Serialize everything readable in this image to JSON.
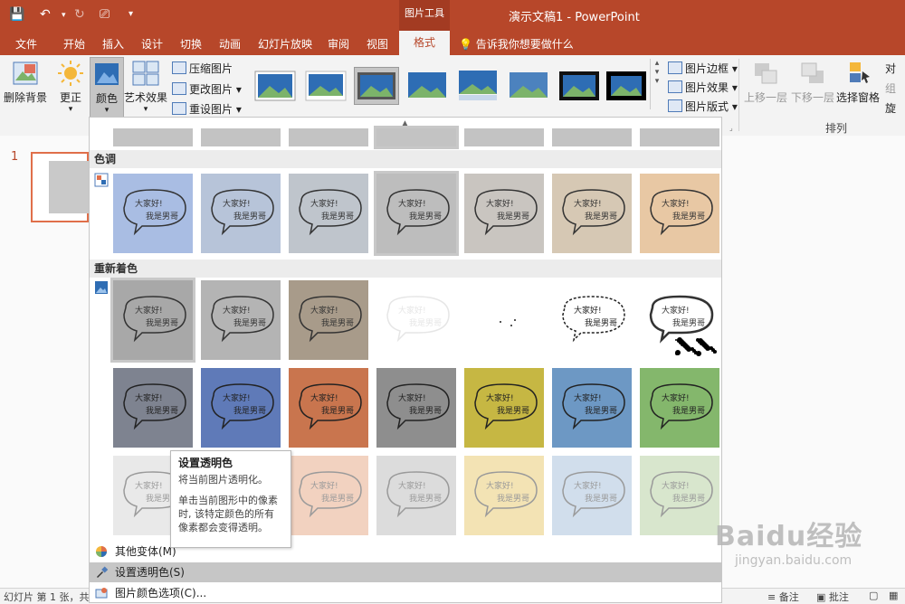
{
  "titlebar": {
    "tool_context": "图片工具",
    "doc_title": "演示文稿1  -  PowerPoint"
  },
  "tabs": [
    {
      "label": "文件"
    },
    {
      "label": "开始"
    },
    {
      "label": "插入"
    },
    {
      "label": "设计"
    },
    {
      "label": "切换"
    },
    {
      "label": "动画"
    },
    {
      "label": "幻灯片放映"
    },
    {
      "label": "审阅"
    },
    {
      "label": "视图"
    },
    {
      "label": "格式"
    }
  ],
  "tellme": "告诉我你想要做什么",
  "ribbon": {
    "remove_bg": "删除背景",
    "corrections": "更正",
    "color": "颜色",
    "artistic": "艺术效果",
    "compress": "压缩图片",
    "change": "更改图片",
    "reset": "重设图片",
    "border": "图片边框",
    "effects": "图片效果",
    "layout": "图片版式",
    "bring_forward": "上移一层",
    "send_backward": "下移一层",
    "selection_pane": "选择窗格",
    "arrange_label": "排列",
    "align_partial": "对",
    "group_partial": "组",
    "rotate_partial": "旋"
  },
  "slidepane": {
    "slide_number": "1"
  },
  "dropdown": {
    "section_tone": "色调",
    "section_recolor": "重新着色",
    "thumb_text_line1": "大家好!",
    "thumb_text_line2": "我是男哥",
    "more_variants": "其他变体(M)",
    "set_transparent": "设置透明色(S)",
    "color_options": "图片颜色选项(C)..."
  },
  "tooltip": {
    "title": "设置透明色",
    "line1": "将当前图片透明化。",
    "line2": "单击当前图形中的像素时, 该特定颜色的所有像素都会变得透明。"
  },
  "status": {
    "slide_info": "幻灯片 第 1 张，共",
    "notes": "备注",
    "comments": "批注"
  },
  "watermark": {
    "brand": "Baidu经验",
    "url": "jingyan.baidu.com"
  },
  "colors": {
    "accent": "#b7472a",
    "tone_row": [
      "#a9bde3",
      "#b7c4d9",
      "#bfc5cc",
      "#bdbdbd",
      "#c9c5c0",
      "#d6c8b4",
      "#e8c8a4"
    ],
    "recolor_row1": [
      "#a8a8a8",
      "#b4b4b4",
      "#a89b8a",
      "#ffffff",
      "#ffffff",
      "#ffffff",
      "#ffffff"
    ],
    "recolor_row2": [
      "#7e8390",
      "#5f7ab8",
      "#c9754e",
      "#8e8e8e",
      "#c6b743",
      "#6d98c4",
      "#84b76c"
    ],
    "recolor_row3": [
      "#e9e9e9",
      "#d5dbe8",
      "#f2d2c0",
      "#dcdcdc",
      "#f3e3b4",
      "#d1deec",
      "#d8e6cd"
    ]
  }
}
